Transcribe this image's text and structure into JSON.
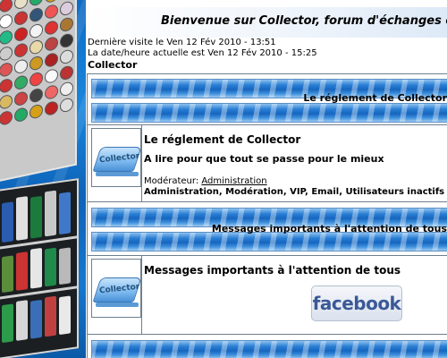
{
  "header": {
    "welcome": "Bienvenue sur Collector, forum d'échanges e",
    "last_visit": "Dernière visite le Ven 12 Fév 2010 - 13:51",
    "current_time": "La date/heure actuelle est Ven 12 Fév 2010 - 15:25",
    "breadcrumb": "Collector"
  },
  "categories": [
    {
      "title": "Le réglement de Collector",
      "forum": {
        "icon_label": "Collector",
        "title": "Le réglement de Collector",
        "description": "A lire pour que tout se passe pour le mieux",
        "moderator_label": "Modérateur:",
        "moderator_name": "Administration",
        "groups": "Administration, Modération, VIP, Email, Utilisateurs inactifs"
      }
    },
    {
      "title": "Messages importants à l'attention de tous",
      "forum": {
        "icon_label": "Collector",
        "title": "Messages importants à l'attention de tous",
        "badge": "facebook"
      }
    }
  ],
  "colors": {
    "band_blue": "#1565bf",
    "border": "#6f7f8c",
    "facebook_blue": "#3b5998",
    "sidebar_blue": "#0f6cc4"
  }
}
